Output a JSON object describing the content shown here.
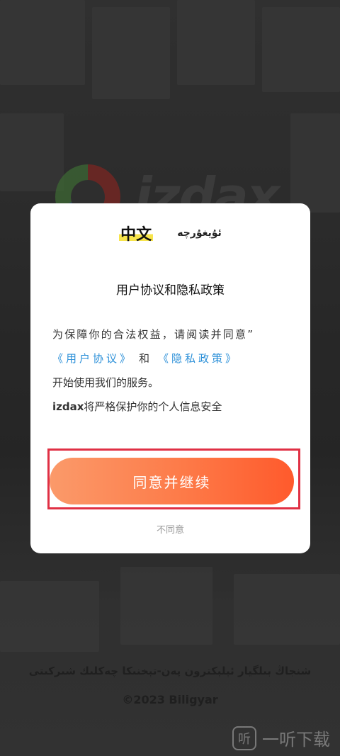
{
  "background": {
    "brand_word": "izdax",
    "company_name": "شنجاڭ بىلگيار ئېلېكترون پەن-تېخنىكا چەكلىك شىركىتى",
    "copyright": "©2023 Biligyar"
  },
  "watermark": {
    "icon_glyph": "听",
    "text": "一听下载"
  },
  "dialog": {
    "languages": {
      "chinese": "中文",
      "uyghur": "ئۇيغۇرچە"
    },
    "title": "用户协议和隐私政策",
    "body": {
      "intro": "为保障你的合法权益，请阅读并同意”",
      "user_agreement": "《用户协议》",
      "and": "和",
      "privacy_policy": "《隐私政策》",
      "start_text": "开始使用我们的服务。",
      "brand": "izdax",
      "safety_text": "将严格保护你的个人信息安全"
    },
    "agree_button": "同意并继续",
    "decline_button": "不同意"
  },
  "colors": {
    "link": "#2a8fd8",
    "button_gradient_start": "#fb9a6a",
    "button_gradient_end": "#ff5a2c",
    "highlight_frame": "#e03044",
    "language_highlight": "#f7e44c"
  }
}
